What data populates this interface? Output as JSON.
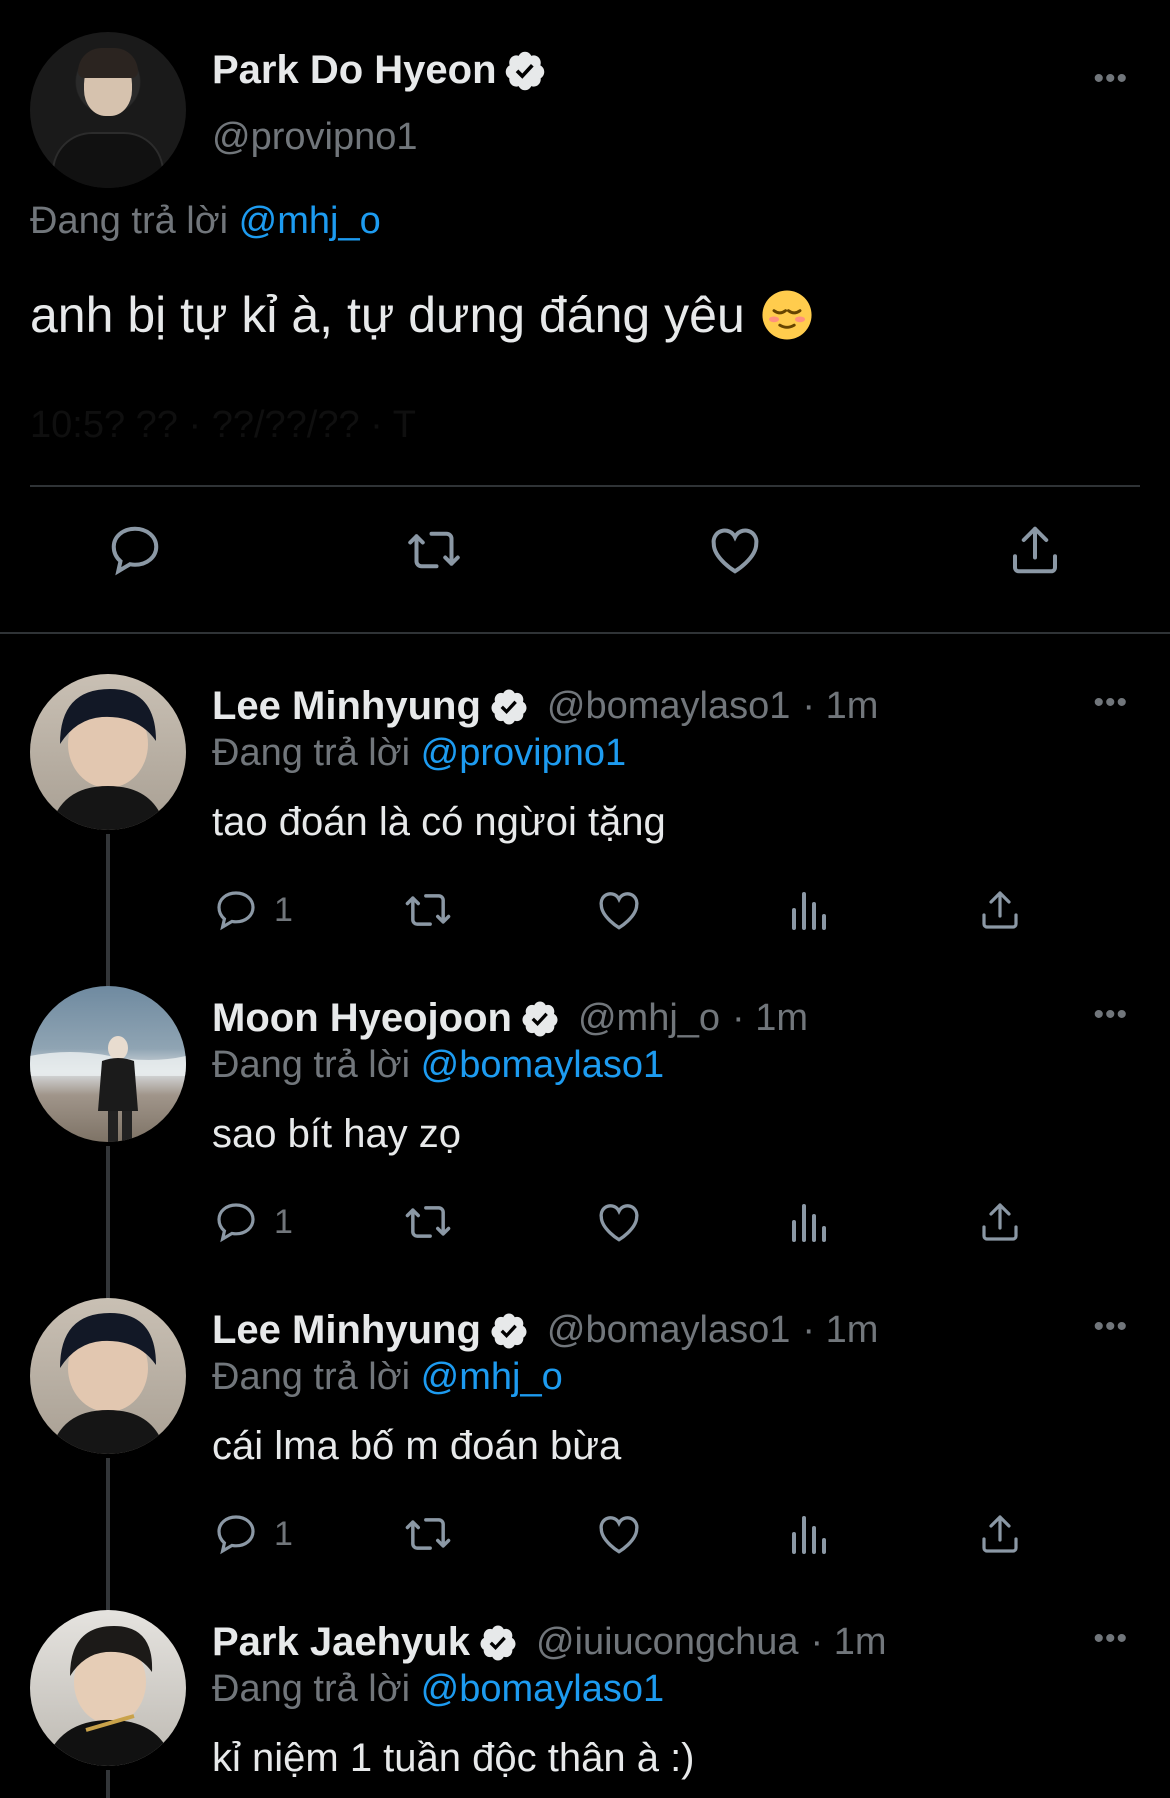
{
  "main_tweet": {
    "author_name": "Park Do Hyeon",
    "author_handle": "@provipno1",
    "replying_prefix": "Đang trả lời",
    "replying_to": "@mhj_o",
    "text": "anh bị tự kỉ à, tự dưng đáng yêu",
    "emoji": "relieved-face-emoji",
    "timestamp": "10:5? ?? · ??/??/?? · T",
    "more_label": "•••",
    "actions": [
      "reply-icon",
      "retweet-icon",
      "like-icon",
      "share-icon"
    ]
  },
  "replies": [
    {
      "name": "Lee Minhyung",
      "handle": "@bomaylaso1",
      "time": "· 1m",
      "replying_prefix": "Đang trả lời",
      "replying_to": "@provipno1",
      "text": "tao đoán là có ngừoi tặng",
      "reply_count": "1",
      "more_label": "•••"
    },
    {
      "name": "Moon Hyeojoon",
      "handle": "@mhj_o",
      "time": "· 1m",
      "replying_prefix": "Đang trả lời",
      "replying_to": "@bomaylaso1",
      "text": "sao bít hay zọ",
      "reply_count": "1",
      "more_label": "•••"
    },
    {
      "name": "Lee Minhyung",
      "handle": "@bomaylaso1",
      "time": "· 1m",
      "replying_prefix": "Đang trả lời",
      "replying_to": "@mhj_o",
      "text": "cái lma bố m đoán bừa",
      "reply_count": "1",
      "more_label": "•••"
    },
    {
      "name": "Park Jaehyuk",
      "handle": "@iuiucongchua",
      "time": "· 1m",
      "replying_prefix": "Đang trả lời",
      "replying_to": "@bomaylaso1",
      "text": "kỉ niệm 1 tuần độc thân à :)",
      "more_label": "•••"
    }
  ],
  "colors": {
    "background": "#000000",
    "text_primary": "#e7e9ea",
    "text_secondary": "#71767b",
    "link": "#1d9bf0",
    "divider": "#2f3336"
  }
}
